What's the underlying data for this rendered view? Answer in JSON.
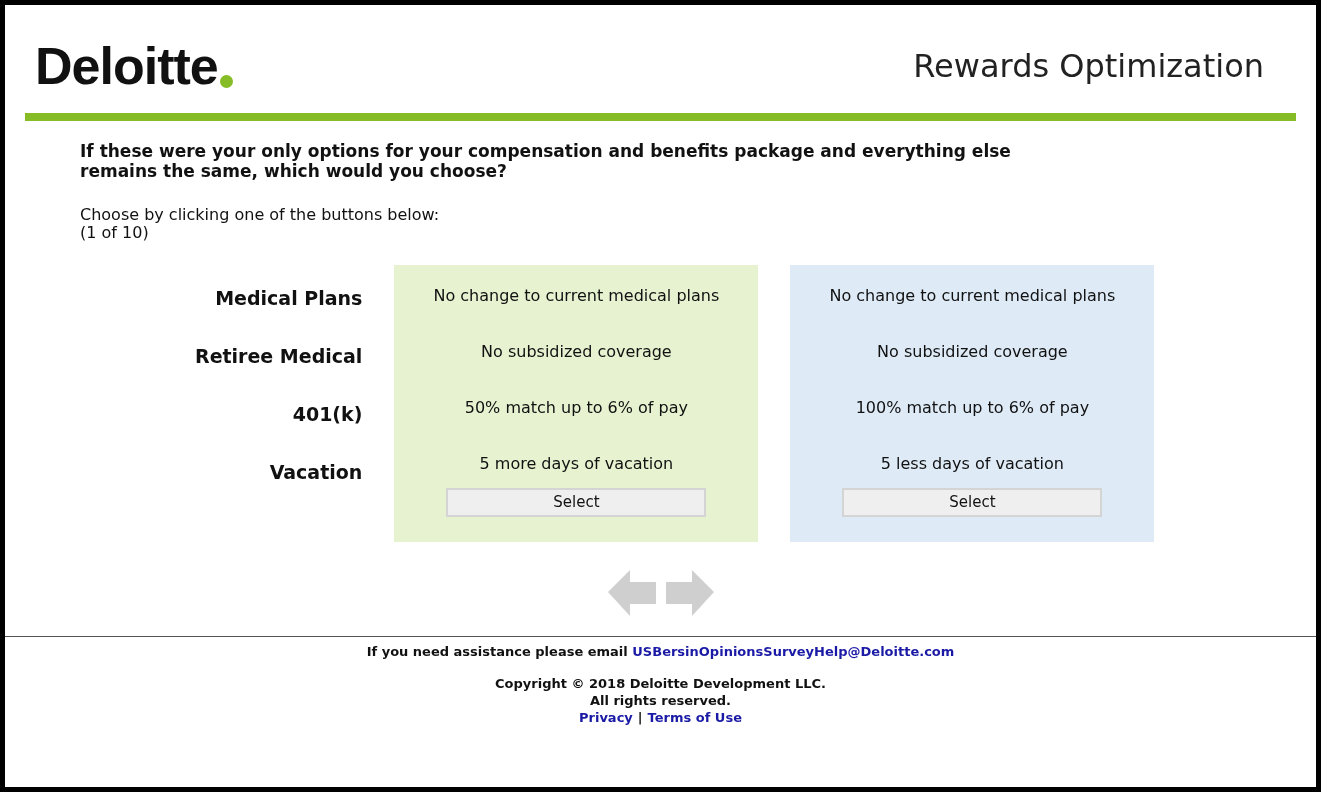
{
  "header": {
    "logo": "Deloitte",
    "title": "Rewards Optimization"
  },
  "question": "If these were your only options for your compensation and benefits package and everything else remains the same, which would you choose?",
  "instruction": "Choose by clicking one of the buttons below:",
  "progress": "(1 of 10)",
  "attributes": [
    "Medical Plans",
    "Retiree Medical",
    "401(k)",
    "Vacation"
  ],
  "options": [
    {
      "color": "#e6f2d0",
      "values": [
        "No change to current medical plans",
        "No subsidized coverage",
        "50% match up to 6% of pay",
        "5 more days of vacation"
      ],
      "button": "Select"
    },
    {
      "color": "#deebf7",
      "values": [
        "No change to current medical plans",
        "No subsidized coverage",
        "100% match up to 6% of pay",
        "5 less days of vacation"
      ],
      "button": "Select"
    }
  ],
  "navigation": [
    {
      "kind": "back",
      "disabled": true
    },
    {
      "kind": "next",
      "disabled": true
    }
  ],
  "footer": {
    "assistance": "If you need assistance please email",
    "email": "USBersinOpinionsSurveyHelp@Deloitte.com",
    "copyright": "Copyright © 2018 Deloitte Development LLC.",
    "rights": "All rights reserved.",
    "links": [
      "Privacy",
      "Terms of Use"
    ],
    "separator": "|"
  }
}
